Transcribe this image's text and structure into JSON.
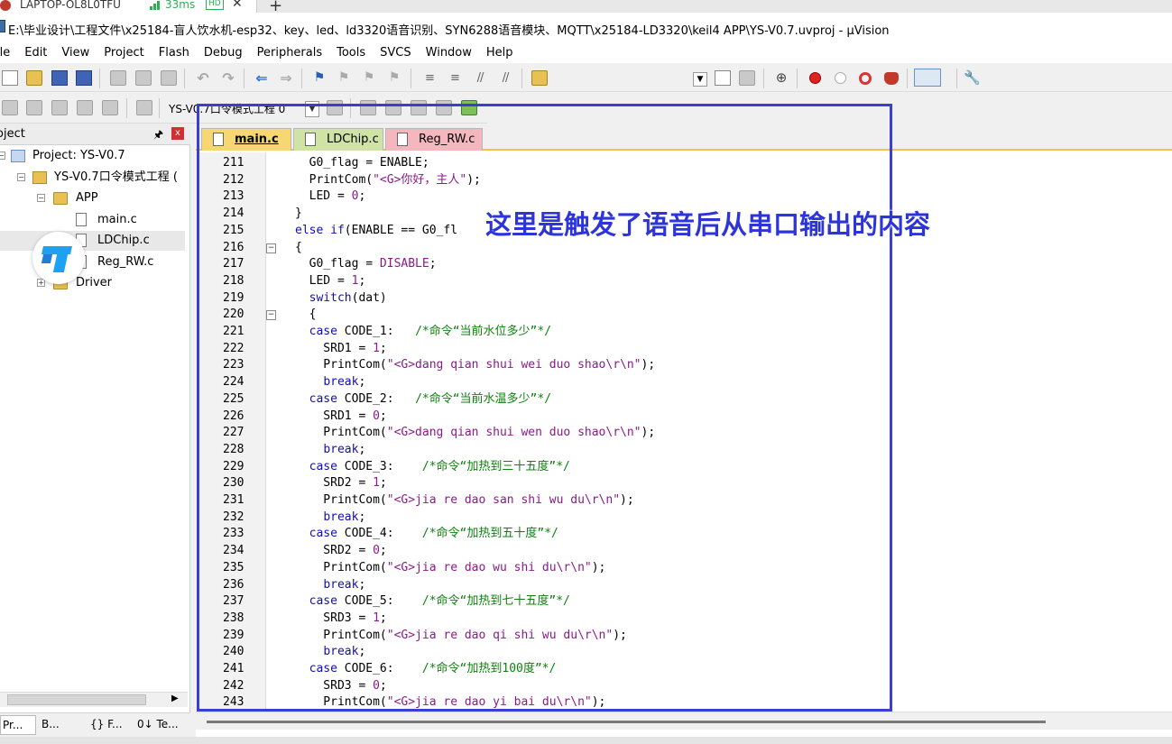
{
  "remote": {
    "host": "LAPTOP-OL8L0TFU",
    "latency": "33ms",
    "quality": "HD",
    "close": "✕",
    "new_tab": "+"
  },
  "window": {
    "title": "E:\\毕业设计\\工程文件\\x25184-盲人饮水机-esp32、key、led、ld3320语音识别、SYN6288语音模块、MQTT\\x25184-LD3320\\keil4 APP\\YS-V0.7.uvproj - µVision"
  },
  "menu": [
    "ile",
    "Edit",
    "View",
    "Project",
    "Flash",
    "Debug",
    "Peripherals",
    "Tools",
    "SVCS",
    "Window",
    "Help"
  ],
  "toolbar2": {
    "target": "YS-V0.7口令模式工程 0"
  },
  "project_panel": {
    "header": "oject",
    "pin": "🖈",
    "close": "x",
    "tree": {
      "root": "Project: YS-V0.7",
      "target": "YS-V0.7口令模式工程 (",
      "group_app": "APP",
      "files": [
        "main.c",
        "LDChip.c",
        "Reg_RW.c"
      ],
      "group_driver": "Driver"
    },
    "tabs": [
      "Pr...",
      "B...",
      "{} F...",
      "0↓ Te..."
    ]
  },
  "editor": {
    "tabs": [
      {
        "label": "main.c",
        "color": "#f7d774"
      },
      {
        "label": "LDChip.c",
        "color": "#cfe3a6"
      },
      {
        "label": "Reg_RW.c",
        "color": "#f3b7bd"
      }
    ],
    "lines": [
      {
        "n": "211",
        "code": "  G0_flag = ENABLE;"
      },
      {
        "n": "212",
        "code": "  PrintCom(\"<G>你好，主人\");"
      },
      {
        "n": "213",
        "code": "  LED = 0;"
      },
      {
        "n": "214",
        "code": "}"
      },
      {
        "n": "215",
        "code": "else if(ENABLE == G0_fl"
      },
      {
        "n": "216",
        "code": "{"
      },
      {
        "n": "217",
        "code": "  G0_flag = DISABLE;"
      },
      {
        "n": "218",
        "code": "  LED = 1;"
      },
      {
        "n": "219",
        "code": "  switch(dat)"
      },
      {
        "n": "220",
        "code": "  {"
      },
      {
        "n": "221",
        "code": "  case CODE_1:   /*命令“当前水位多少”*/"
      },
      {
        "n": "222",
        "code": "    SRD1 = 1;"
      },
      {
        "n": "223",
        "code": "    PrintCom(\"<G>dang qian shui wei duo shao\\r\\n\");"
      },
      {
        "n": "224",
        "code": "    break;"
      },
      {
        "n": "225",
        "code": "  case CODE_2:   /*命令“当前水温多少”*/"
      },
      {
        "n": "226",
        "code": "    SRD1 = 0;"
      },
      {
        "n": "227",
        "code": "    PrintCom(\"<G>dang qian shui wen duo shao\\r\\n\");"
      },
      {
        "n": "228",
        "code": "    break;"
      },
      {
        "n": "229",
        "code": "  case CODE_3:    /*命令“加热到三十五度”*/"
      },
      {
        "n": "230",
        "code": "    SRD2 = 1;"
      },
      {
        "n": "231",
        "code": "    PrintCom(\"<G>jia re dao san shi wu du\\r\\n\");"
      },
      {
        "n": "232",
        "code": "    break;"
      },
      {
        "n": "233",
        "code": "  case CODE_4:    /*命令“加热到五十度”*/"
      },
      {
        "n": "234",
        "code": "    SRD2 = 0;"
      },
      {
        "n": "235",
        "code": "    PrintCom(\"<G>jia re dao wu shi du\\r\\n\");"
      },
      {
        "n": "236",
        "code": "    break;"
      },
      {
        "n": "237",
        "code": "  case CODE_5:    /*命令“加热到七十五度”*/"
      },
      {
        "n": "238",
        "code": "    SRD3 = 1;"
      },
      {
        "n": "239",
        "code": "    PrintCom(\"<G>jia re dao qi shi wu du\\r\\n\");"
      },
      {
        "n": "240",
        "code": "    break;"
      },
      {
        "n": "241",
        "code": "  case CODE_6:    /*命令“加热到100度”*/"
      },
      {
        "n": "242",
        "code": "    SRD3 = 0;"
      },
      {
        "n": "243",
        "code": "    PrintCom(\"<G>jia re dao yi bai du\\r\\n\");"
      }
    ],
    "fold_lines": [
      "216",
      "220"
    ]
  },
  "annotation": {
    "text": "这里是触发了语音后从串口输出的内容",
    "color": "#2d35d8"
  }
}
